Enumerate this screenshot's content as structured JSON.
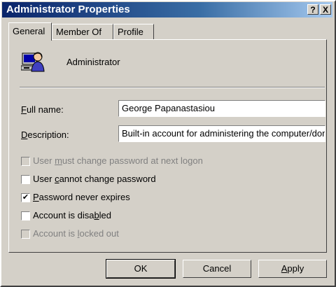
{
  "window": {
    "title": "Administrator Properties"
  },
  "titlebar_buttons": {
    "help": "?",
    "close": "X"
  },
  "tabs": [
    {
      "label": "General",
      "active": true
    },
    {
      "label": "Member Of",
      "active": false
    },
    {
      "label": "Profile",
      "active": false
    }
  ],
  "user": {
    "icon": "user-computer-icon",
    "name": "Administrator"
  },
  "fields": {
    "full_name": {
      "label_pre": "",
      "label_ul": "F",
      "label_post": "ull name:",
      "value": "George Papanastasiou"
    },
    "description": {
      "label_pre": "",
      "label_ul": "D",
      "label_post": "escription:",
      "value": "Built-in account for administering the computer/domain"
    }
  },
  "checkboxes": [
    {
      "pre": "User ",
      "ul": "m",
      "post": "ust change password at next logon",
      "checked": false,
      "enabled": false
    },
    {
      "pre": "User ",
      "ul": "c",
      "post": "annot change password",
      "checked": false,
      "enabled": true
    },
    {
      "pre": "",
      "ul": "P",
      "post": "assword never expires",
      "checked": true,
      "enabled": true
    },
    {
      "pre": "Account is disa",
      "ul": "b",
      "post": "led",
      "checked": false,
      "enabled": true
    },
    {
      "pre": "Account is ",
      "ul": "l",
      "post": "ocked out",
      "checked": false,
      "enabled": false
    }
  ],
  "buttons": {
    "ok": "OK",
    "cancel": "Cancel",
    "apply_ul": "A",
    "apply_post": "pply"
  }
}
